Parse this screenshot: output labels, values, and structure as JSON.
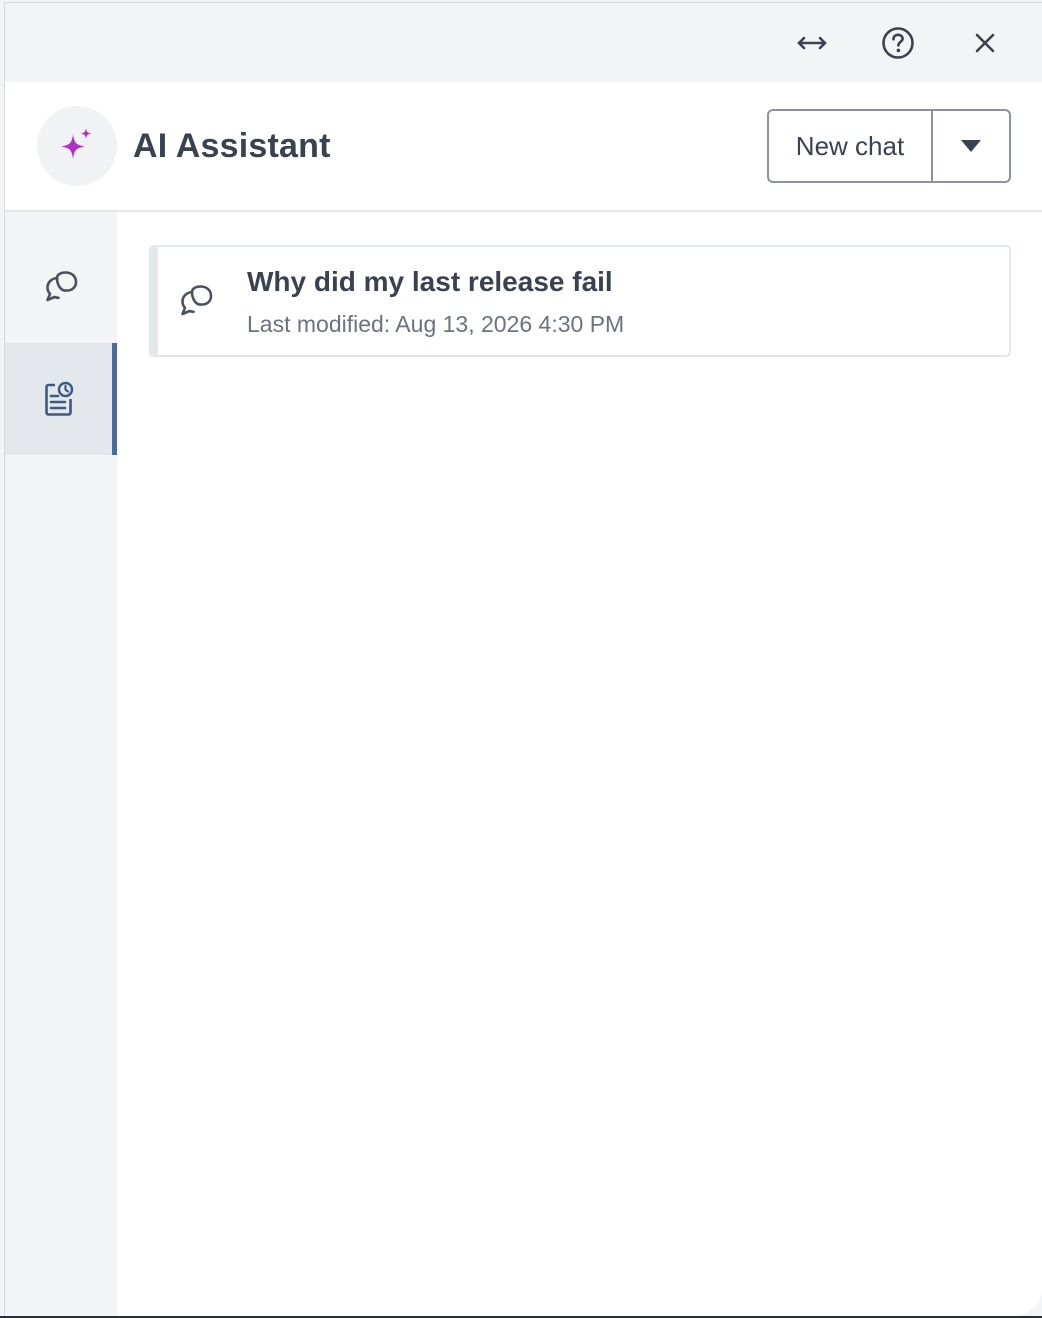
{
  "topbar": {
    "icons": [
      "resize-horizontal-icon",
      "help-circle-icon",
      "close-icon"
    ]
  },
  "header": {
    "logo_icon": "sparkle-icon",
    "title": "AI Assistant",
    "new_chat_label": "New chat",
    "dropdown_icon": "caret-down-icon"
  },
  "sidenav": {
    "items": [
      {
        "icon": "chat-bubbles-icon",
        "active": false
      },
      {
        "icon": "chat-history-icon",
        "active": true
      }
    ]
  },
  "chats": [
    {
      "icon": "chat-bubbles-icon",
      "title": "Why did my last release fail",
      "subtitle": "Last modified: Aug 13, 2026 4:30 PM"
    }
  ],
  "colors": {
    "accent": "#4a6a9a",
    "sparkle": "#b02fc4",
    "text": "#3a4150",
    "muted": "#6b7280",
    "panel_gray": "#f3f4f6"
  }
}
